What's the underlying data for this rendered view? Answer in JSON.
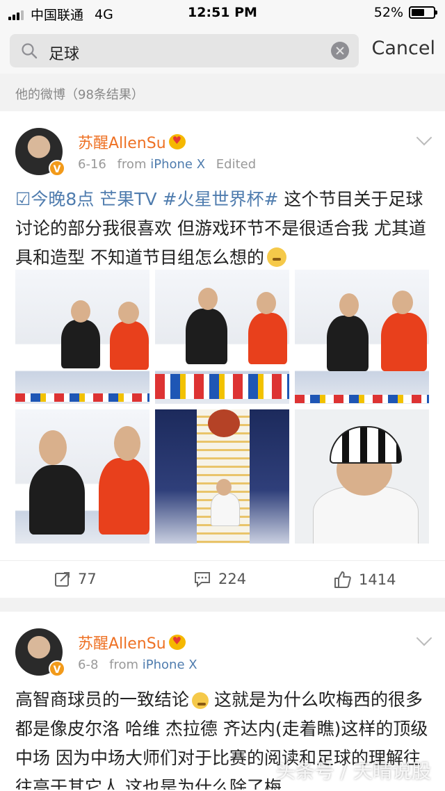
{
  "status_bar": {
    "carrier": "中国联通",
    "network": "4G",
    "time": "12:51 PM",
    "battery": "52%",
    "battery_level": 0.52
  },
  "search": {
    "query": "足球",
    "cancel_label": "Cancel"
  },
  "results_header": "他的微博（98条结果）",
  "posts": [
    {
      "username": "苏醒AllenSu",
      "date": "6-16",
      "from_label": "from",
      "source": "iPhone X",
      "edited": "Edited",
      "text_tag": "☑今晚8点 芒果TV #火星世界杯#",
      "text_body": " 这个节目关于足球讨论的部分我很喜欢 但游戏环节不是很适合我 尤其道具和造型 不知道节目组怎么想的",
      "reposts": "77",
      "comments": "224",
      "likes": "1414"
    },
    {
      "username": "苏醒AllenSu",
      "date": "6-8",
      "from_label": "from",
      "source": "iPhone X",
      "text_part1": "高智商球员的一致结论",
      "text_part2": " 这就是为什么吹梅西的很多都是像皮尔洛 哈维 杰拉德 齐达内(走着瞧)这样的顶级中场 因为中场大师们对于比赛的阅读和足球的理解往往高于其它人 这也是为什么除了梅"
    }
  ],
  "watermark": "头条号 / 天晴说股",
  "icons": {
    "search": "search-icon",
    "clear": "clear-icon",
    "repost": "repost-icon",
    "comment": "comment-icon",
    "like": "like-icon",
    "verified": "verified-badge-icon",
    "crown": "crown-icon",
    "chevron": "chevron-down-icon"
  },
  "colors": {
    "username": "#ee7124",
    "link": "#4f7cae",
    "verified_badge": "#f29a1a"
  }
}
